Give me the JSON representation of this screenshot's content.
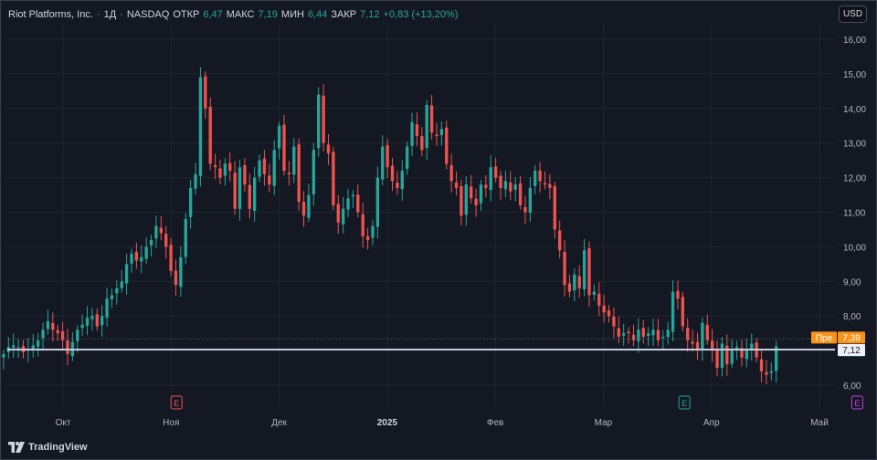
{
  "header": {
    "symbol_name": "Riot Platforms, Inc.",
    "interval": "1Д",
    "exchange": "NASDAQ",
    "open_label": "ОТКР",
    "open_value": "6,47",
    "high_label": "МАКС",
    "high_value": "7,19",
    "low_label": "МИН",
    "low_value": "6,44",
    "close_label": "ЗАКР",
    "close_value": "7,12",
    "change": "+0,83 (+13,20%)"
  },
  "currency_button": "USD",
  "brand": "TradingView",
  "price_labels": {
    "premarket_tag": "Пре",
    "premarket_value": "7,39",
    "last_value": "7,12",
    "line_value": "7,12"
  },
  "events": [
    {
      "label": "E",
      "month_index": 1.05,
      "color": "#ef5350"
    },
    {
      "label": "E",
      "month_index": 5.75,
      "color": "#26a69a"
    },
    {
      "label": "E",
      "month_index": 7.35,
      "color": "#c040e0"
    }
  ],
  "colors": {
    "background": "#141823",
    "up": "#26a69a",
    "down": "#ef5350",
    "grid": "#22262f",
    "horizontal_line": "#c5cbe0",
    "premarket": "#f7931a"
  },
  "chart_data": {
    "type": "candlestick",
    "title": "Riot Platforms, Inc.",
    "interval": "1Д",
    "exchange": "NASDAQ",
    "currency": "USD",
    "ylim": [
      5.5,
      16.5
    ],
    "y_ticks": [
      "6,00",
      "7,00",
      "8,00",
      "9,00",
      "10,00",
      "11,00",
      "12,00",
      "13,00",
      "14,00",
      "15,00",
      "16,00"
    ],
    "y_tick_values": [
      6,
      7,
      8,
      9,
      10,
      11,
      12,
      13,
      14,
      15,
      16
    ],
    "x_ticks": [
      "Окт",
      "Ноя",
      "Дек",
      "2025",
      "Фев",
      "Мар",
      "Апр",
      "Май"
    ],
    "x_tick_bold": [
      false,
      false,
      false,
      true,
      false,
      false,
      false,
      false
    ],
    "x_tick_month_index": [
      0,
      1,
      2,
      3,
      4,
      5,
      6,
      7
    ],
    "start_month_index": -0.55,
    "end_month_index": 6.6,
    "horizontal_line_value": 7.03,
    "last_close": 7.12,
    "premarket_value": 7.39,
    "closes": [
      6.9,
      7.1,
      7.15,
      7.1,
      6.95,
      7.05,
      7.15,
      7.3,
      7.6,
      7.85,
      7.6,
      7.5,
      7.3,
      6.9,
      7.25,
      7.6,
      7.75,
      7.95,
      8.0,
      7.7,
      8.0,
      8.5,
      8.6,
      8.8,
      9.0,
      9.5,
      9.8,
      9.6,
      9.7,
      10.0,
      10.2,
      10.6,
      10.4,
      10.0,
      9.3,
      8.9,
      9.7,
      10.8,
      11.7,
      12.1,
      14.9,
      14.0,
      12.4,
      12.3,
      12.0,
      12.4,
      12.2,
      11.1,
      12.3,
      11.8,
      11.1,
      12.0,
      12.5,
      12.1,
      11.8,
      12.8,
      13.5,
      12.2,
      12.1,
      12.9,
      11.3,
      10.9,
      11.5,
      12.8,
      14.4,
      13.0,
      12.7,
      11.2,
      10.7,
      11.1,
      11.4,
      11.5,
      11.0,
      10.3,
      10.2,
      10.6,
      12.0,
      12.9,
      12.3,
      11.9,
      11.7,
      12.2,
      12.9,
      13.6,
      13.2,
      12.8,
      14.1,
      13.3,
      13.2,
      13.4,
      12.4,
      11.9,
      11.7,
      10.9,
      11.8,
      11.4,
      11.2,
      11.8,
      11.7,
      12.3,
      12.0,
      11.7,
      11.9,
      11.6,
      11.8,
      11.2,
      11.0,
      11.7,
      12.2,
      11.9,
      11.8,
      11.7,
      10.5,
      9.9,
      8.9,
      8.7,
      9.2,
      8.8,
      9.9,
      8.6,
      8.7,
      8.3,
      8.1,
      8.0,
      7.7,
      7.4,
      7.5,
      7.5,
      7.3,
      7.6,
      7.4,
      7.5,
      7.6,
      7.3,
      7.4,
      7.6,
      8.7,
      8.5,
      7.7,
      7.3,
      7.2,
      7.0,
      7.8,
      7.3,
      7.0,
      6.5,
      7.2,
      6.6,
      7.0,
      7.1,
      6.8,
      7.0,
      7.2,
      6.8,
      6.4,
      6.3,
      6.4,
      7.12
    ]
  }
}
